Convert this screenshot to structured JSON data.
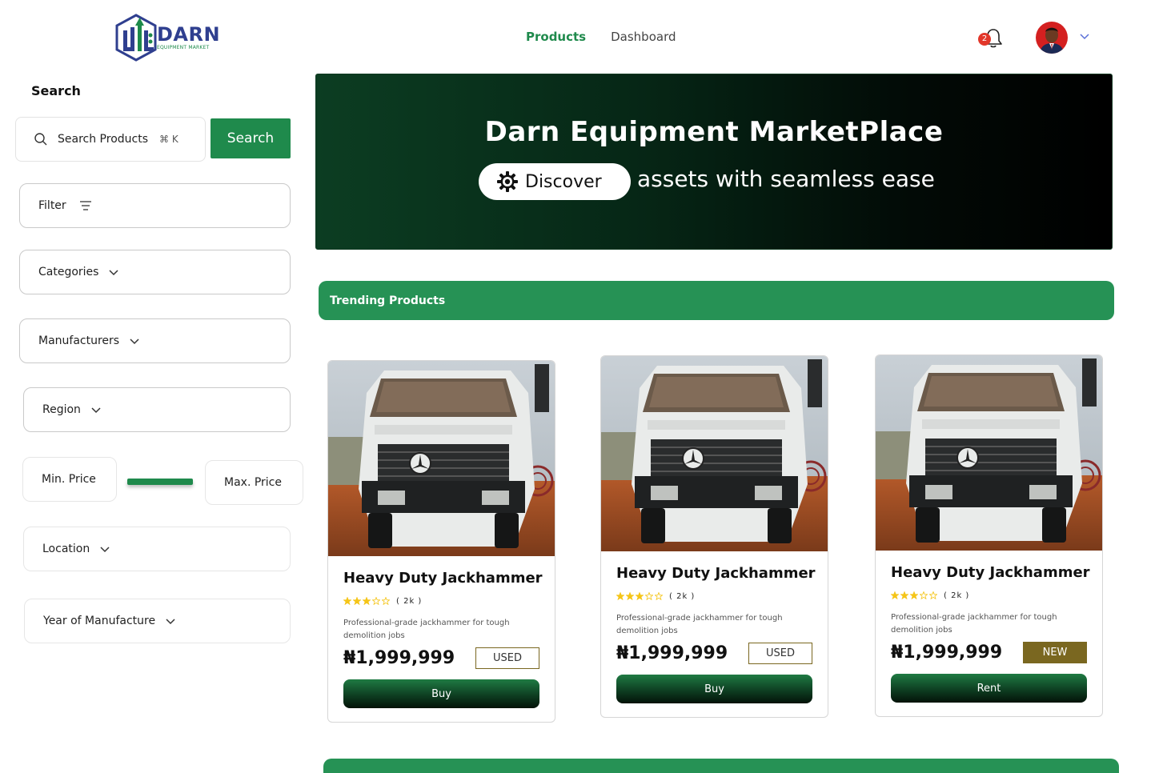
{
  "header": {
    "logo_word": "DARN",
    "logo_sub": "EQUIPMENT MARKET",
    "nav": [
      {
        "label": "Products",
        "active": true
      },
      {
        "label": "Dashboard",
        "active": false
      }
    ],
    "notifications_count": "2"
  },
  "sidebar": {
    "search_title": "Search",
    "search_placeholder": "Search Products",
    "search_shortcut": "⌘ K",
    "search_button": "Search",
    "filter_label": "Filter",
    "categories_label": "Categories",
    "manufacturers_label": "Manufacturers",
    "region_label": "Region",
    "min_price_label": "Min. Price",
    "max_price_label": "Max. Price",
    "location_label": "Location",
    "year_label": "Year of Manufacture"
  },
  "hero": {
    "title": "Darn Equipment MarketPlace",
    "pill_label": "Discover",
    "subtitle": "assets with seamless ease"
  },
  "section": {
    "trending_label": "Trending Products"
  },
  "products": [
    {
      "title": "Heavy Duty Jackhammer",
      "rating": 3,
      "rating_count": "( 2k )",
      "description": "Professional-grade jackhammer for tough demolition jobs",
      "price": "₦1,999,999",
      "condition": "USED",
      "action": "Buy"
    },
    {
      "title": "Heavy Duty Jackhammer",
      "rating": 3,
      "rating_count": "( 2k )",
      "description": "Professional-grade jackhammer for tough demolition jobs",
      "price": "₦1,999,999",
      "condition": "USED",
      "action": "Buy"
    },
    {
      "title": "Heavy Duty Jackhammer",
      "rating": 3,
      "rating_count": "( 2k )",
      "description": "Professional-grade jackhammer for tough demolition jobs",
      "price": "₦1,999,999",
      "condition": "NEW",
      "action": "Rent"
    }
  ],
  "colors": {
    "brand_green": "#1f8a4c",
    "section_green": "#269255",
    "star_gold": "#f5c518",
    "badge_gold": "#7a6720",
    "logo_blue": "#2f3f8f"
  }
}
